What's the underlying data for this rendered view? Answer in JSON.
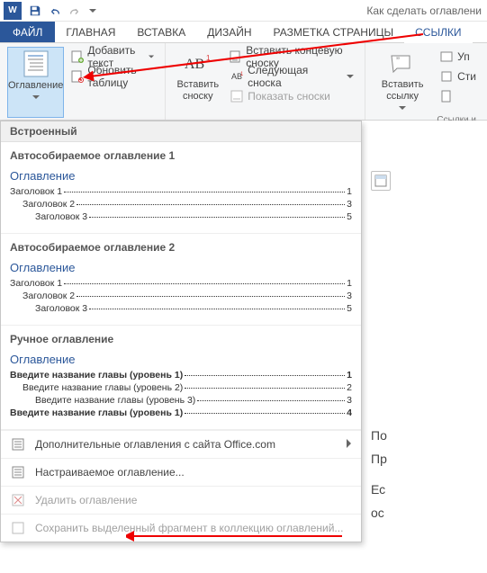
{
  "title": "Как сделать оглавлени",
  "tabs": {
    "file": "ФАЙЛ",
    "home": "ГЛАВНАЯ",
    "insert": "ВСТАВКА",
    "design": "ДИЗАЙН",
    "layout": "РАЗМЕТКА СТРАНИЦЫ",
    "references": "ССЫЛКИ"
  },
  "ribbon": {
    "toc_btn": "Оглавление",
    "add_text": "Добавить текст",
    "update_table": "Обновить таблицу",
    "insert_footnote": "Вставить сноску",
    "insert_endnote": "Вставить концевую сноску",
    "next_footnote": "Следующая сноска",
    "show_footnotes": "Показать сноски",
    "insert_link": "Вставить ссылку",
    "up_prefix": "Уп",
    "sty_prefix": "Сти",
    "links_and": "Ссылки и"
  },
  "dropdown": {
    "builtin": "Встроенный",
    "auto1": {
      "title": "Автособираемое оглавление 1",
      "toc_title": "Оглавление",
      "h1": "Заголовок 1",
      "h2": "Заголовок 2",
      "h3": "Заголовок 3",
      "p1": "1",
      "p2": "3",
      "p3": "5"
    },
    "auto2": {
      "title": "Автособираемое оглавление 2",
      "toc_title": "Оглавление",
      "h1": "Заголовок 1",
      "h2": "Заголовок 2",
      "h3": "Заголовок 3",
      "p1": "1",
      "p2": "3",
      "p3": "5"
    },
    "manual": {
      "title": "Ручное оглавление",
      "toc_title": "Оглавление",
      "r1": "Введите название главы (уровень 1)",
      "r2": "Введите название главы (уровень 2)",
      "r3": "Введите название главы (уровень 3)",
      "r4": "Введите название главы (уровень 1)",
      "p1": "1",
      "p2": "2",
      "p3": "3",
      "p4": "4"
    },
    "more_office": "Дополнительные оглавления с сайта Office.com",
    "custom": "Настраиваемое оглавление...",
    "remove": "Удалить оглавление",
    "save_sel": "Сохранить выделенный фрагмент в коллекцию оглавлений..."
  },
  "doc": {
    "line1": "По",
    "line2": "Пр",
    "line3": "Ес",
    "line4": "ос"
  }
}
